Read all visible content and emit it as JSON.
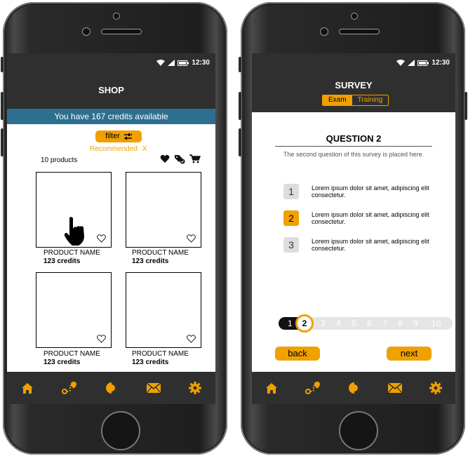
{
  "status": {
    "time": "12:30"
  },
  "shop": {
    "title": "SHOP",
    "credits_banner": "You have 167 credits available",
    "filter_label": "filter",
    "recommended_label": "Recommended",
    "recommended_clear": "X",
    "product_count": "10 products",
    "products": [
      {
        "name": "PRODUCT  NAME",
        "credits": "123 credits"
      },
      {
        "name": "PRODUCT  NAME",
        "credits": "123 credits"
      },
      {
        "name": "PRODUCT  NAME",
        "credits": "123 credits"
      },
      {
        "name": "PRODUCT  NAME",
        "credits": "123 credits"
      }
    ]
  },
  "survey": {
    "title": "SURVEY",
    "tabs": [
      "Exam",
      "Training"
    ],
    "question_title": "QUESTION 2",
    "question_desc": "The second question of this survey is placed here.",
    "options": [
      {
        "num": "1",
        "text": "Lorem ipsum dolor sit amet, adipiscing elit consectetur."
      },
      {
        "num": "2",
        "text": "Lorem ipsum dolor sit amet, adipiscing elit consectetur."
      },
      {
        "num": "3",
        "text": "Lorem ipsum dolor sit amet, adipiscing elit consectetur."
      }
    ],
    "pages": [
      "1",
      "2",
      "3",
      "4",
      "5",
      "6",
      "7",
      "8",
      "9",
      "10"
    ],
    "back_label": "back",
    "next_label": "next"
  },
  "tabbar": {
    "icons": [
      "home-icon",
      "route-icon",
      "pie-icon",
      "mail-icon",
      "gear-icon"
    ]
  },
  "colors": {
    "accent": "#f0a000",
    "banner": "#2d6f8f",
    "bar": "#2f2f2f"
  }
}
